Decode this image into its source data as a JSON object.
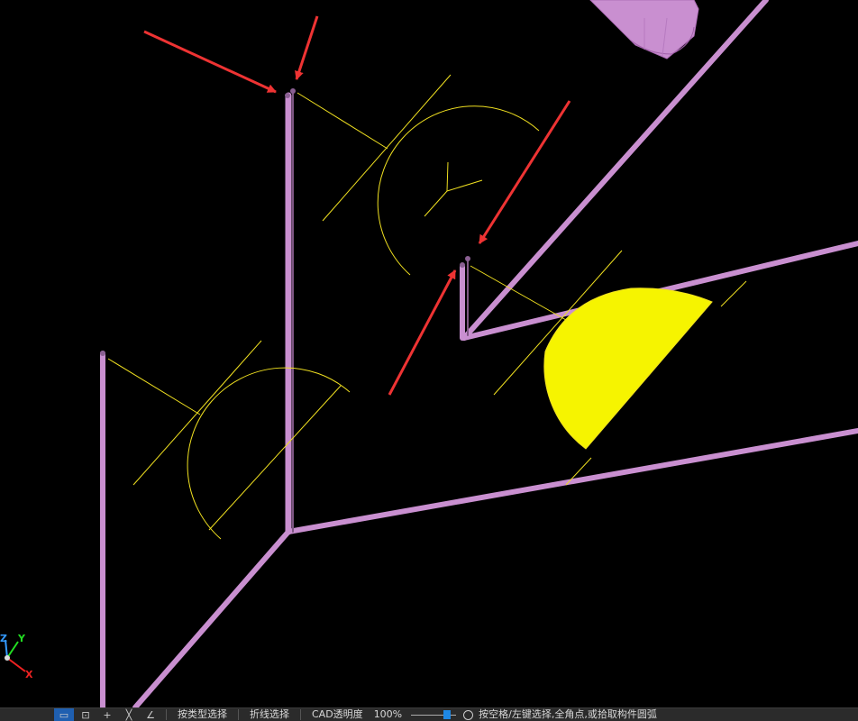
{
  "viewport": {
    "background": "#000000",
    "pipe_color": "#c98fd0",
    "annotation_color": "#f0e020",
    "fill_color": "#f6f400",
    "arrow_color": "#ee3333"
  },
  "axis_gizmo": {
    "x_label": "X",
    "y_label": "Y",
    "z_label": "Z"
  },
  "statusbar": {
    "tool_icons": [
      "select-icon",
      "window-icon",
      "plus-icon",
      "cross-icon",
      "angle-icon"
    ],
    "model_select_label": "按类型选择",
    "polyline_select_label": "折线选择",
    "cad_transparency_label": "CAD透明度",
    "cad_transparency_value": "100%",
    "hint_text": "按空格/左键选择,全角点,或拾取构件圆弧"
  }
}
